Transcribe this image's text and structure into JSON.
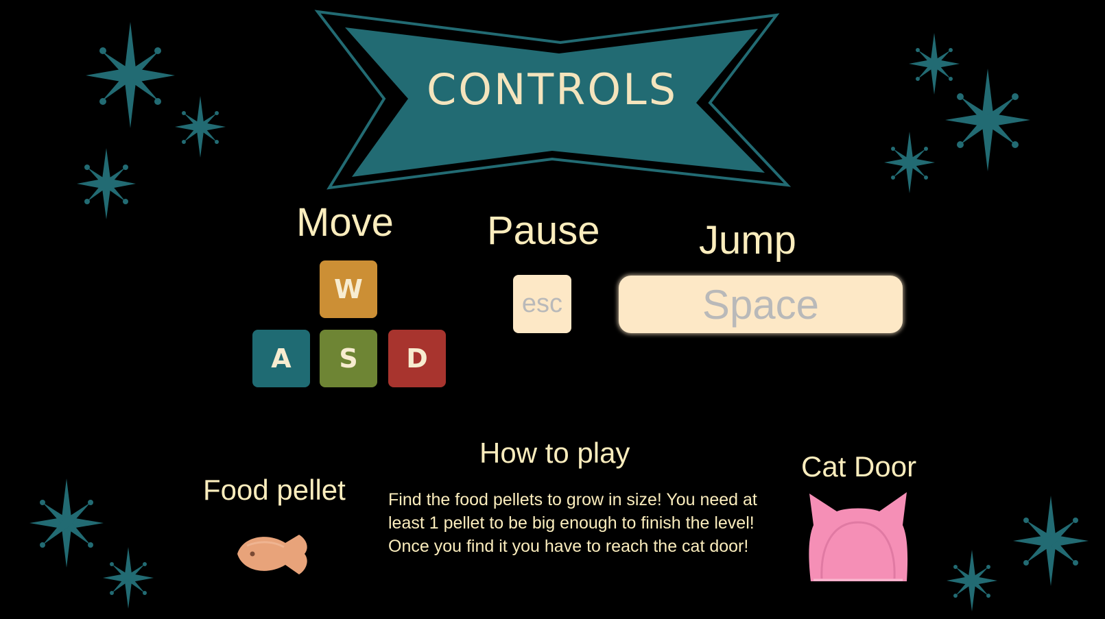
{
  "screen_title": "CONTROLS",
  "colors": {
    "background": "#000000",
    "teal": "#226b73",
    "text_cream": "#fbedbd",
    "key_w": "#cc8f35",
    "key_a": "#1f6b73",
    "key_s": "#6e8534",
    "key_d": "#a8342e",
    "esc_space_bg": "#fde8c6",
    "esc_space_text": "#b9b9b9",
    "pellet": "#e8a37a",
    "cat_door": "#f58fb6"
  },
  "controls": {
    "move": {
      "label": "Move",
      "keys": {
        "w": "W",
        "a": "A",
        "s": "S",
        "d": "D"
      }
    },
    "pause": {
      "label": "Pause",
      "key": "esc"
    },
    "jump": {
      "label": "Jump",
      "key": "Space"
    }
  },
  "how_to_play": {
    "title": "How to play",
    "lines": [
      "Find the food pellets to grow in size! You need at",
      "least 1 pellet to be big enough to finish the level!",
      "Once you find it you have to reach the cat door!"
    ]
  },
  "food_pellet": {
    "label": "Food pellet",
    "icon": "fish-pellet-icon"
  },
  "cat_door": {
    "label": "Cat Door",
    "icon": "cat-door-icon"
  },
  "decorations": {
    "icon": "sparkle-star-icon"
  }
}
